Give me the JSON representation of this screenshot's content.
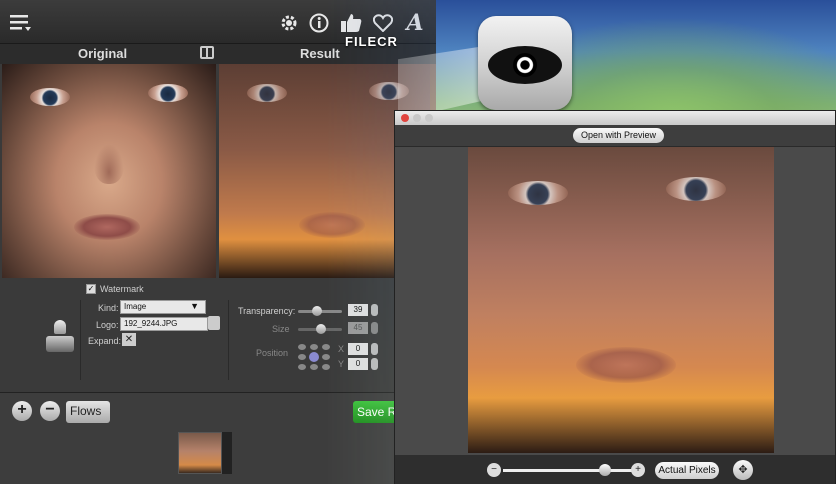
{
  "app": {
    "panels": {
      "original": "Original",
      "result": "Result"
    },
    "toolbar": {
      "menu_icon": "list-icon",
      "icons": [
        "gear-icon",
        "info-icon",
        "thumbs-up-icon",
        "heart-icon",
        "font-icon"
      ]
    },
    "watermark": {
      "checkbox_label": "Watermark",
      "checked": true,
      "kind_label": "Kind:",
      "kind_value": "Image",
      "logo_label": "Logo:",
      "logo_value": "192_9244.JPG",
      "expand_label": "Expand:",
      "transparency_label": "Transparency:",
      "transparency_value": "39",
      "size_label": "Size",
      "size_value": "45",
      "position_label": "Position",
      "x_label": "X",
      "x_value": "0",
      "y_label": "Y",
      "y_value": "0"
    },
    "flows": {
      "add": "+",
      "remove": "−",
      "flows_label": "Flows",
      "save_label": "Save Re"
    }
  },
  "overlay": {
    "watermark_text": "FILECR",
    "eye_icon": "eye-icon"
  },
  "preview": {
    "open_with": "Open with Preview",
    "actual_pixels": "Actual Pixels",
    "zoom_level": 0.75
  }
}
